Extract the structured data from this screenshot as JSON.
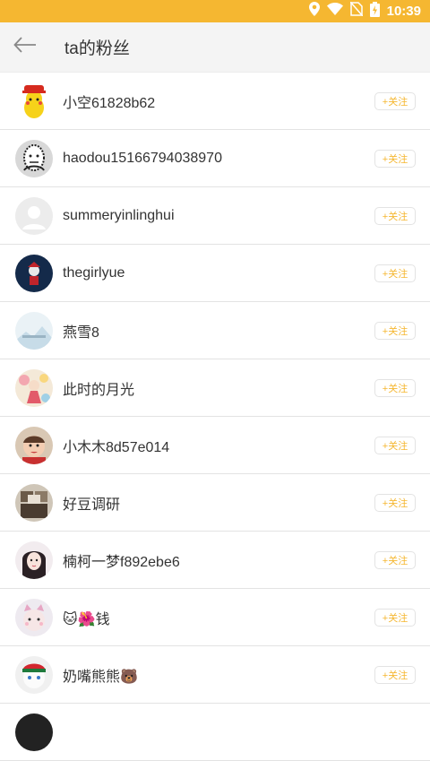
{
  "status": {
    "time": "10:39"
  },
  "header": {
    "title": "ta的粉丝",
    "back_icon": "arrow-left-icon"
  },
  "accent_color": "#f5b731",
  "follow_label": "+关注",
  "users": [
    {
      "name": "小空61828b62"
    },
    {
      "name": "haodou15166794038970"
    },
    {
      "name": "summeryinlinghui"
    },
    {
      "name": "thegirlyue"
    },
    {
      "name": "燕雪8"
    },
    {
      "name": "此时的月光"
    },
    {
      "name": "小木木8d57e014"
    },
    {
      "name": "好豆调研"
    },
    {
      "name": "楠柯一梦f892ebe6"
    },
    {
      "name": "🐱🌺钱"
    },
    {
      "name": "奶嘴熊熊🐻"
    }
  ]
}
